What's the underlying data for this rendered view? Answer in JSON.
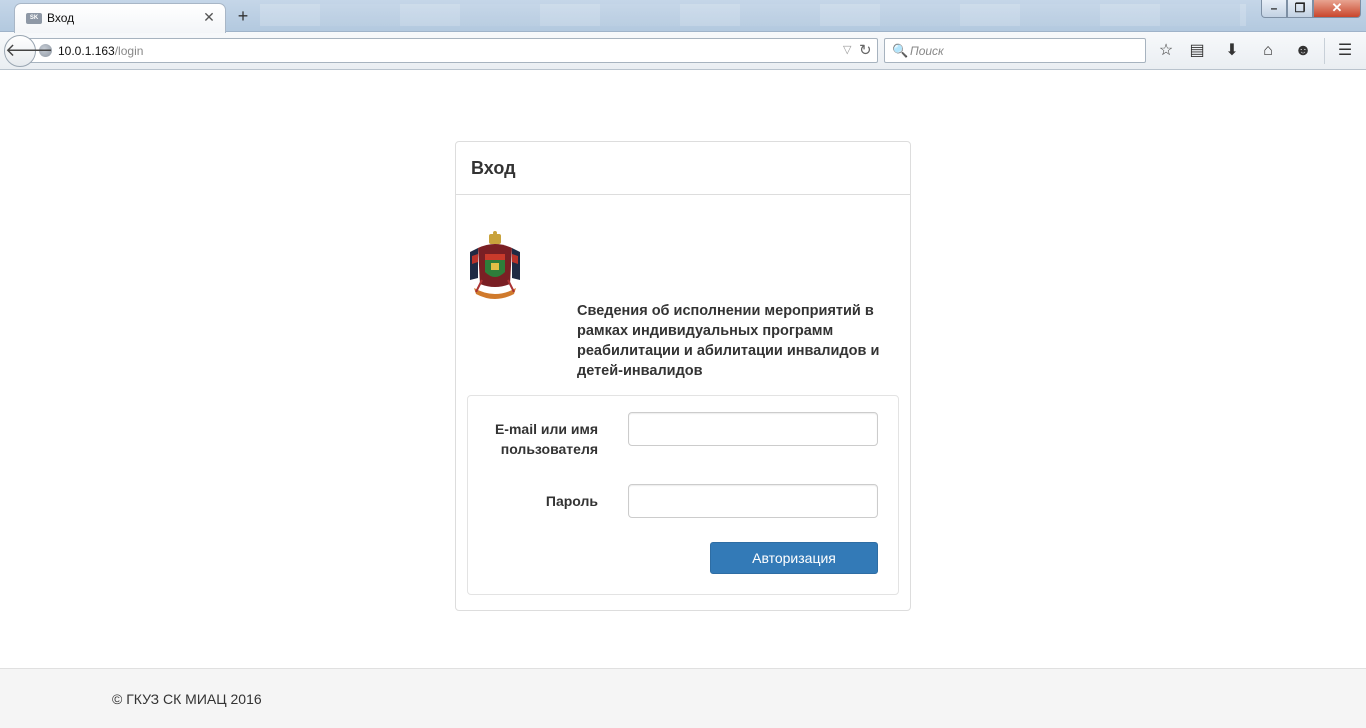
{
  "browser": {
    "tab": {
      "favicon_text": "SK",
      "title": "Вход",
      "close_glyph": "✕"
    },
    "new_tab_glyph": "+",
    "window_controls": {
      "minimize_glyph": "–",
      "maximize_glyph": "❐",
      "close_glyph": "✕"
    },
    "back_glyph": "🡐",
    "url": {
      "host": "10.0.1.163",
      "path": "/login"
    },
    "url_dropdown_glyph": "▽",
    "reload_glyph": "↻",
    "search": {
      "placeholder": "Поиск",
      "icon_glyph": "🔍"
    },
    "toolbar_icons": [
      {
        "name": "bookmark-star-icon",
        "glyph": "☆"
      },
      {
        "name": "reading-list-icon",
        "glyph": "▤"
      },
      {
        "name": "download-icon",
        "glyph": "⬇"
      },
      {
        "name": "home-icon",
        "glyph": "⌂"
      },
      {
        "name": "chat-icon",
        "glyph": "☻"
      },
      {
        "name": "menu-icon",
        "glyph": "☰"
      }
    ]
  },
  "login_panel": {
    "title": "Вход",
    "info_text": "Сведения об исполнении мероприятий в рамках индивидуальных программ реабилитации и абилитации инвалидов и детей-инвалидов",
    "fields": {
      "login_label": "E-mail или имя пользователя",
      "login_value": "",
      "password_label": "Пароль",
      "password_value": ""
    },
    "submit_label": "Авторизация"
  },
  "footer": {
    "text": "© ГКУЗ СК МИАЦ 2016"
  },
  "colors": {
    "primary_button": "#337ab7",
    "panel_border": "#dddddd",
    "footer_bg": "#f5f5f5"
  }
}
